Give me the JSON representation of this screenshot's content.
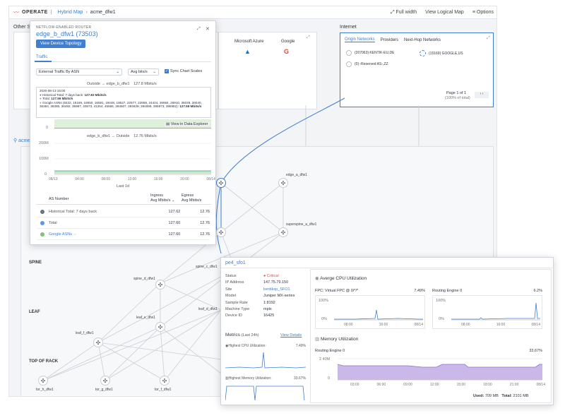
{
  "topbar": {
    "product": "OPERATE",
    "crumb1": "Hybrid Map",
    "crumb2": "acme_dfw1",
    "full_width": "Full width",
    "view_logical": "View Logical Map",
    "options": "Options"
  },
  "sections": {
    "other": "Other S",
    "internet": "Internet",
    "site": "acme"
  },
  "clouds": [
    {
      "name": "Microsoft Azure",
      "icon": "azure-icon"
    },
    {
      "name": "Google",
      "icon": "google-icon"
    }
  ],
  "internet_card": {
    "tabs": [
      "Origin Networks",
      "Providers",
      "Next-Hop Networks"
    ],
    "items": [
      "(207063) KENTIK-EU,DE",
      "(15169) GOOGLE,US",
      "(0) -Reserved AS-,ZZ"
    ],
    "page": "Page 1 of 1",
    "page_sub": "(100% of total)"
  },
  "router_popup": {
    "kicker": "NETFLOW-ENABLED ROUTER",
    "title": "edge_b_dfw1 (73503)",
    "button": "View Device Topology",
    "tab": "Traffic",
    "select1": "External Traffic By ASN",
    "select2": "Avg bits/s",
    "sync": "Sync Chart Scales",
    "chart1_header_left": "Outside",
    "chart1_header_right": "edge_b_dfw1",
    "chart1_header_value": "127.8 Mbits/s",
    "tooltip": {
      "date": "2020-08-13 15:00",
      "hist": "Historical Total: 7 days back:",
      "hist_val": "127.83 Mbits/s",
      "total": "Total:",
      "total_val": "127.59 Mbits/s",
      "google": "Google ASNs (6432, 15169, 16550, 16591, 19448, 19527, 22577, 22859, 24424, 26684, 26910, 36039, 36040, 36384, 36385, 36492, 36987, 40873, 41264, 45566, 394507, 394639, 394699, 395973, 396982):",
      "google_val": "127.59 Mbits/s"
    },
    "zero_label": "0",
    "explorer_link": "View in Data Explorer",
    "chart2_header_left": "edge_b_dfw1",
    "chart2_header_right": "Outside",
    "chart2_header_value": "12.76 Mbits/s",
    "chart2_y": [
      "200M",
      "100M",
      "0"
    ],
    "chart2_x": [
      "08/13",
      "04:00",
      "08:00",
      "12:00",
      "16:00",
      "20:00",
      "08/14"
    ],
    "chart2_caption": "Last 1d",
    "table_head": {
      "asn": "AS Number",
      "ingress": "Ingress",
      "ingress_sub": "Avg Mbits/s",
      "egress": "Egress",
      "egress_sub": "Avg Mbits/s"
    },
    "rows": [
      {
        "name": "Historical Total: 7 days back",
        "ingress": "127.62",
        "egress": "12.76",
        "color": "#6b7280"
      },
      {
        "name": "Total",
        "ingress": "127.60",
        "egress": "12.76",
        "color": "#5b9be0"
      },
      {
        "name": "Google ASNs",
        "ingress": "127.60",
        "egress": "12.76",
        "color": "#7cc576"
      }
    ]
  },
  "topology": {
    "tiers": [
      "SPINE",
      "LEAF",
      "TOP OF RACK"
    ],
    "nodes": {
      "edge_a": "edge_a_dfw1",
      "superspine_a": "superspine_a_dfw1",
      "spine_c": "spine_c_dfw1",
      "spine_d": "spine_d_dfw1",
      "leaf_e": "leaf_e_dfw1",
      "leaf_f": "leaf_f_dfw1",
      "leaf_d": "leaf_d_dfw1",
      "tor_h": "tor_h_dfw1",
      "tor_g": "tor_g_dfw1",
      "tor_f": "tor_f_dfw1"
    }
  },
  "device_popup": {
    "title": "pe4_sfo1",
    "fields": [
      {
        "label": "Status",
        "value": "Critical"
      },
      {
        "label": "IP Address",
        "value": "147.75.79.150"
      },
      {
        "label": "Site",
        "value": "kentiksp_SFO1"
      },
      {
        "label": "Model",
        "value": "Juniper MX-series"
      },
      {
        "label": "Sample Rate",
        "value": "1:8192"
      },
      {
        "label": "Machine Type",
        "value": "mpls"
      },
      {
        "label": "Device ID",
        "value": "16425"
      }
    ],
    "metrics_title": "Metrics",
    "metrics_sub": "(Last 24h)",
    "view_details": "View Details",
    "highest_cpu": "Highest CPU Utilization:",
    "highest_cpu_val": "7.49%",
    "highest_mem": "Highest Memory Utilization:",
    "highest_mem_val": "33.67%",
    "cpu_title": "Averge CPU Utilization",
    "fpc_label": "FPC: Virtual FPC @ 0/*/*",
    "fpc_val": "7.49%",
    "re_label": "Routing Engine 0",
    "re_val": "6.2%",
    "cpu_y": [
      "100%",
      "0%"
    ],
    "cpu_x": [
      "08:00",
      "16:00",
      "08/14"
    ],
    "mem_title": "Memory Utilization",
    "mem_re_label": "Routing Engine 0",
    "mem_re_val": "33.67%",
    "mem_y": [
      "2 40M",
      "0"
    ],
    "mem_x": [
      "03:00",
      "06:00",
      "09:00",
      "12:00",
      "15:00",
      "18:00",
      "21:00",
      "08/14"
    ],
    "used_label": "Used:",
    "used_val": "709 MB",
    "total_label": "Total:",
    "total_val": "2101 MB"
  },
  "colors": {
    "accent": "#3f7ed1",
    "critical": "#d9534f",
    "series_fill": "#c9b8e8",
    "series_line": "#8a73c9",
    "cpu_line": "#3f7ed1"
  }
}
